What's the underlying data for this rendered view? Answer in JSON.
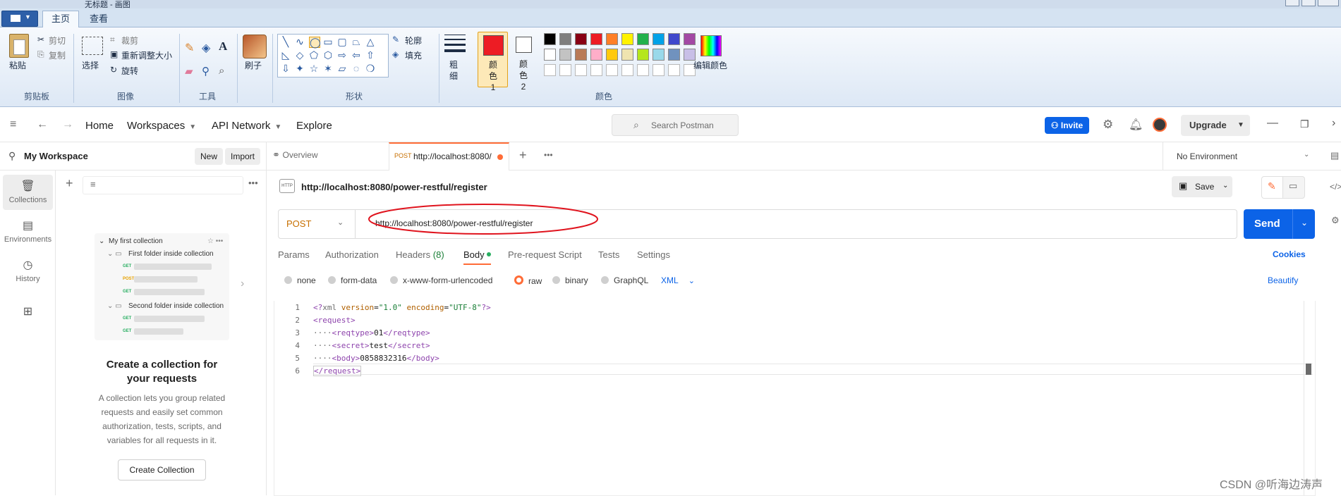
{
  "paint": {
    "title": "无标题 - 画图",
    "tabs": [
      "主页",
      "查看"
    ],
    "clipboard": {
      "paste": "粘贴",
      "cut": "剪切",
      "copy": "复制",
      "group": "剪贴板"
    },
    "image": {
      "select": "选择",
      "crop": "裁剪",
      "resize": "重新调整大小",
      "rotate": "旋转",
      "group": "图像"
    },
    "tools": {
      "group": "工具"
    },
    "brush": "刷子",
    "shapes": {
      "outline": "轮廓",
      "fill": "填充",
      "group": "形状"
    },
    "size": "粗细",
    "color1": "颜色 1",
    "color2": "颜色 2",
    "edit_colors": "编辑颜色",
    "colors_group": "颜色",
    "palette_row1": [
      "#000000",
      "#7f7f7f",
      "#880015",
      "#ed1c24",
      "#ff7f27",
      "#fff200",
      "#22b14c",
      "#00a2e8",
      "#3f48cc",
      "#a349a4"
    ],
    "palette_row2": [
      "#ffffff",
      "#c3c3c3",
      "#b97a57",
      "#ffaec9",
      "#ffc90e",
      "#efe4b0",
      "#b5e61d",
      "#99d9ea",
      "#7092be",
      "#c8bfe7"
    ],
    "color1_value": "#ed1c24",
    "color2_value": "#ffffff"
  },
  "postman": {
    "nav": {
      "home": "Home",
      "workspaces": "Workspaces",
      "api_network": "API Network",
      "explore": "Explore"
    },
    "search_placeholder": "Search Postman",
    "invite": "Invite",
    "upgrade": "Upgrade",
    "workspace": {
      "name": "My Workspace",
      "new": "New",
      "import": "Import"
    },
    "sidebar_nav": [
      {
        "label": "Collections",
        "icon": "collections-icon"
      },
      {
        "label": "Environments",
        "icon": "environments-icon"
      },
      {
        "label": "History",
        "icon": "history-icon"
      }
    ],
    "preview": {
      "collection": "My first collection",
      "folder1": "First folder inside collection",
      "folder2": "Second folder inside collection",
      "methods": [
        "GET",
        "POST",
        "GET",
        "GET",
        "GET"
      ]
    },
    "empty_state": {
      "title": "Create a collection for your requests",
      "body": "A collection lets you group related requests and easily set common authorization, tests, scripts, and variables for all requests in it.",
      "button": "Create Collection"
    },
    "tabs": {
      "overview": "Overview",
      "active_method": "POST",
      "active_url": "http://localhost:8080/"
    },
    "environment": "No Environment",
    "request": {
      "title_url": "http://localhost:8080/power-restful/register",
      "method": "POST",
      "url": "http://localhost:8080/power-restful/register",
      "send": "Send",
      "save": "Save"
    },
    "request_tabs": [
      "Params",
      "Authorization",
      "Headers",
      "Body",
      "Pre-request Script",
      "Tests",
      "Settings"
    ],
    "headers_count": "(8)",
    "cookies": "Cookies",
    "body_types": [
      "none",
      "form-data",
      "x-www-form-urlencoded",
      "raw",
      "binary",
      "GraphQL"
    ],
    "body_format": "XML",
    "beautify": "Beautify",
    "code_lines": [
      "1",
      "2",
      "3",
      "4",
      "5",
      "6"
    ]
  },
  "watermark": "CSDN @听海边涛声"
}
